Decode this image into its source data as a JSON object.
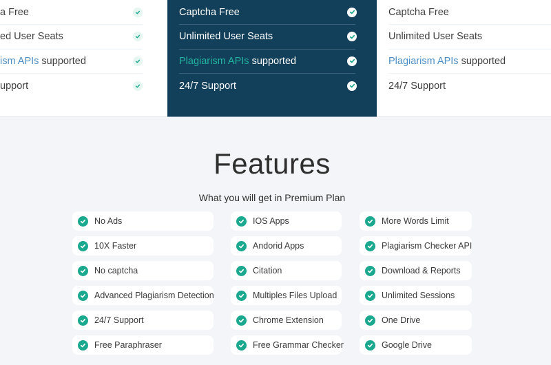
{
  "pricing": {
    "plans": [
      {
        "id": "left",
        "features": [
          {
            "prefix": "",
            "highlight": "",
            "text": "a Free"
          },
          {
            "prefix": "",
            "highlight": "",
            "text": "ed User Seats"
          },
          {
            "prefix": "",
            "highlight": "ism APIs",
            "text": " supported"
          },
          {
            "prefix": "",
            "highlight": "",
            "text": "upport"
          }
        ],
        "check_icon": "check-circle-icon"
      },
      {
        "id": "middle",
        "features": [
          {
            "highlight": "",
            "text": "Captcha Free"
          },
          {
            "highlight": "",
            "text": "Unlimited User Seats"
          },
          {
            "highlight": "Plagiarism APIs",
            "text": " supported"
          },
          {
            "highlight": "",
            "text": "24/7 Support"
          }
        ],
        "check_icon": "check-circle-icon",
        "colors": {
          "background": "#123f5a",
          "highlight": "#22b5a0"
        }
      },
      {
        "id": "right",
        "features": [
          {
            "highlight": "",
            "text": "Captcha Free"
          },
          {
            "highlight": "",
            "text": "Unlimited User Seats"
          },
          {
            "highlight": "Plagiarism APIs",
            "text": " supported"
          },
          {
            "highlight": "",
            "text": "24/7 Support"
          }
        ]
      }
    ],
    "colors": {
      "link_highlight": "#4d8fc6",
      "check": "#1aa88f"
    }
  },
  "features": {
    "title": "Features",
    "subtitle": "What you will get in Premium Plan",
    "columns": [
      [
        "No Ads",
        "10X Faster",
        "No captcha",
        "Advanced Plagiarism Detection",
        "24/7 Support",
        "Free Paraphraser"
      ],
      [
        "IOS Apps",
        "Andorid Apps",
        "Citation",
        "Multiples Files Upload",
        "Chrome Extension",
        "Free Grammar Checker"
      ],
      [
        "More Words Limit",
        "Plagiarism Checker API",
        "Download & Reports",
        "Unlimited Sessions",
        "One Drive",
        "Google Drive"
      ]
    ],
    "item_icon": "check-circle-icon"
  }
}
